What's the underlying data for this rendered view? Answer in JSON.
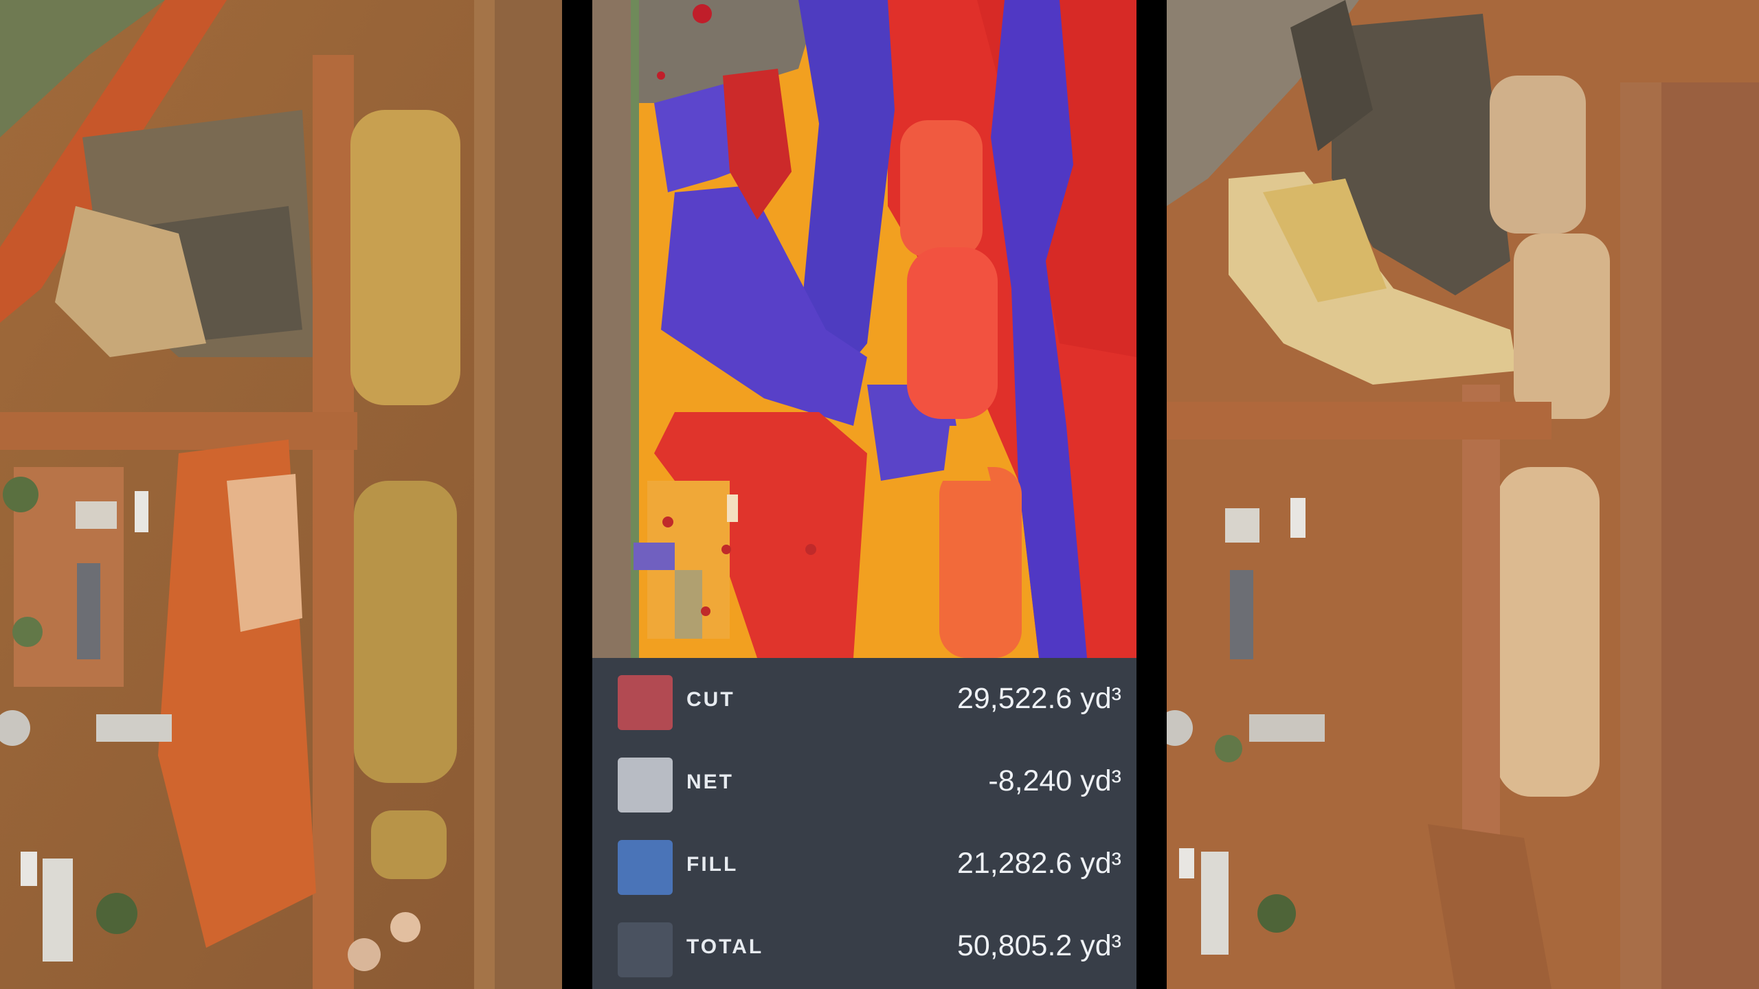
{
  "legend": {
    "rows": [
      {
        "label": "CUT",
        "value": "29,522.6 yd³",
        "color": "#b24a52"
      },
      {
        "label": "NET",
        "value": "-8,240 yd³",
        "color": "#b8bcc4"
      },
      {
        "label": "FILL",
        "value": "21,282.6 yd³",
        "color": "#4a74b8"
      },
      {
        "label": "TOTAL",
        "value": "50,805.2 yd³",
        "color": "#4a5260"
      }
    ]
  },
  "colors": {
    "background": "#000000",
    "legend_panel": "#383e48",
    "cut_overlay": "#e02a2a",
    "fill_overlay": "#5040c8",
    "neutral_overlay": "#f2a020"
  }
}
